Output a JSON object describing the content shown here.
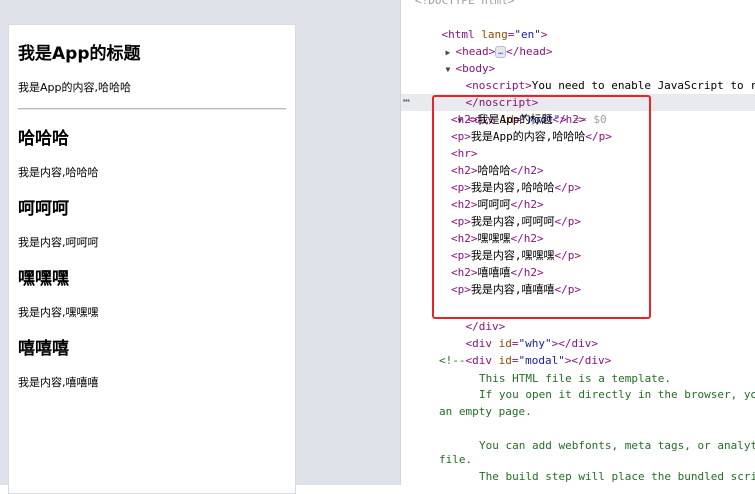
{
  "preview": {
    "app_title": "我是App的标题",
    "app_content": "我是App的内容,哈哈哈",
    "sections": [
      {
        "heading": "哈哈哈",
        "text": "我是内容,哈哈哈"
      },
      {
        "heading": "呵呵呵",
        "text": "我是内容,呵呵呵"
      },
      {
        "heading": "嘿嘿嘿",
        "text": "我是内容,嘿嘿嘿"
      },
      {
        "heading": "嘻嘻嘻",
        "text": "我是内容,嘻嘻嘻"
      }
    ]
  },
  "devtools": {
    "doctype": "<!DOCTYPE html>",
    "html_open_tag": "<html",
    "html_attr_name": " lang",
    "html_attr_eq": "=",
    "html_attr_value": "\"en\"",
    "html_open_close": ">",
    "head_open": "<head>",
    "head_ellipsis": "…",
    "head_close": "</head>",
    "body_open": "<body>",
    "noscript_open": "<noscript>",
    "noscript_text": "You need to enable JavaScript to run this app.",
    "noscript_close": "</noscript>",
    "div_root_open": "<div",
    "div_root_attr": " id",
    "div_root_eq": "=",
    "div_root_value": "\"root\"",
    "div_root_gt": ">",
    "div_root_marker": " == $0",
    "root_children": [
      {
        "open": "<h2>",
        "text": "我是App的标题",
        "close": "</h2>"
      },
      {
        "open": "<p>",
        "text": "我是App的内容,哈哈哈",
        "close": "</p>"
      },
      {
        "open": "<hr>",
        "text": "",
        "close": ""
      },
      {
        "open": "<h2>",
        "text": "哈哈哈",
        "close": "</h2>"
      },
      {
        "open": "<p>",
        "text": "我是内容,哈哈哈",
        "close": "</p>"
      },
      {
        "open": "<h2>",
        "text": "呵呵呵",
        "close": "</h2>"
      },
      {
        "open": "<p>",
        "text": "我是内容,呵呵呵",
        "close": "</p>"
      },
      {
        "open": "<h2>",
        "text": "嘿嘿嘿",
        "close": "</h2>"
      },
      {
        "open": "<p>",
        "text": "我是内容,嘿嘿嘿",
        "close": "</p>"
      },
      {
        "open": "<h2>",
        "text": "嘻嘻嘻",
        "close": "</h2>"
      },
      {
        "open": "<p>",
        "text": "我是内容,嘻嘻嘻",
        "close": "</p>"
      }
    ],
    "div_root_close": "</div>",
    "div_why": {
      "open": "<div",
      "attr": " id",
      "eq": "=",
      "value": "\"why\"",
      "gt": ">",
      "close": "</div>"
    },
    "div_modal": {
      "open": "<div",
      "attr": " id",
      "eq": "=",
      "value": "\"modal\"",
      "gt": ">",
      "close": "</div>"
    },
    "comment_open": "<!--",
    "comment_lines": [
      "This HTML file is a template.",
      "If you open it directly in the browser, you will see",
      "an empty page.",
      "",
      "You can add webfonts, meta tags, or analytics to this",
      "file.",
      "The build step will place the bundled scripts"
    ],
    "dots": "⋯"
  },
  "colors": {
    "tag": "#881280",
    "attr": "#994500",
    "value": "#1a1aa6",
    "comment": "#236e25",
    "highlight": "#e8232a"
  }
}
